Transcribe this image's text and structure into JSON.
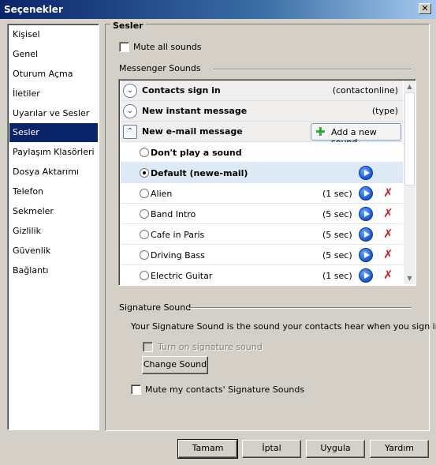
{
  "window": {
    "title": "Seçenekler",
    "close_glyph": "✕"
  },
  "nav": {
    "items": [
      {
        "label": "Kişisel"
      },
      {
        "label": "Genel"
      },
      {
        "label": "Oturum Açma"
      },
      {
        "label": "İletiler"
      },
      {
        "label": "Uyarılar ve Sesler"
      },
      {
        "label": "Sesler",
        "selected": true
      },
      {
        "label": "Paylaşım Klasörleri"
      },
      {
        "label": "Dosya Aktarımı"
      },
      {
        "label": "Telefon"
      },
      {
        "label": "Sekmeler"
      },
      {
        "label": "Gizlilik"
      },
      {
        "label": "Güvenlik"
      },
      {
        "label": "Bağlantı"
      }
    ]
  },
  "sounds": {
    "section_title": "Sesler",
    "mute_all_label": "Mute all sounds",
    "mute_all_checked": false,
    "messenger_sounds_label": "Messenger Sounds",
    "groups": {
      "contacts_sign_in": {
        "label": "Contacts sign in",
        "value": "(contactonline)",
        "expanded": false
      },
      "new_instant_message": {
        "label": "New instant message",
        "value": "(type)",
        "expanded": false
      },
      "new_email_message": {
        "label": "New e-mail message",
        "expanded": true,
        "add_button_label": "Add a new sound"
      }
    },
    "options": [
      {
        "name": "Don't play a sound",
        "bold": true,
        "duration": "",
        "selected": false
      },
      {
        "name": "Default (newe-mail)",
        "bold": true,
        "duration": "",
        "selected": true
      },
      {
        "name": "Alien",
        "bold": false,
        "duration": "(1 sec)",
        "selected": false
      },
      {
        "name": "Band Intro",
        "bold": false,
        "duration": "(5 sec)",
        "selected": false
      },
      {
        "name": "Cafe in Paris",
        "bold": false,
        "duration": "(5 sec)",
        "selected": false
      },
      {
        "name": "Driving Bass",
        "bold": false,
        "duration": "(5 sec)",
        "selected": false
      },
      {
        "name": "Electric Guitar",
        "bold": false,
        "duration": "(1 sec)",
        "selected": false
      }
    ],
    "icons": {
      "chevron_down": "chevron-down-icon",
      "chevron_up": "chevron-up-icon",
      "play": "play-icon",
      "delete": "delete-icon",
      "add": "plus-icon"
    },
    "glyphs": {
      "chevron_down": "⌄",
      "chevron_up": "⌃",
      "delete": "✗",
      "plus": "✚",
      "scroll_up": "▲",
      "scroll_down": "▼"
    }
  },
  "signature": {
    "section_label": "Signature Sound",
    "description": "Your Signature Sound is the sound your contacts hear when you sign in",
    "turn_on_label": "Turn on signature sound",
    "turn_on_enabled": false,
    "change_button": "Change Sound",
    "mute_contacts_label": "Mute my contacts' Signature Sounds",
    "mute_contacts_checked": false
  },
  "buttons": {
    "ok": "Tamam",
    "cancel": "İptal",
    "apply": "Uygula",
    "help": "Yardım"
  },
  "colors": {
    "selection": "#0a246a",
    "window_bg": "#d4d0c8",
    "play_blue": "#1f5fd8",
    "delete_red": "#d21e1e"
  }
}
